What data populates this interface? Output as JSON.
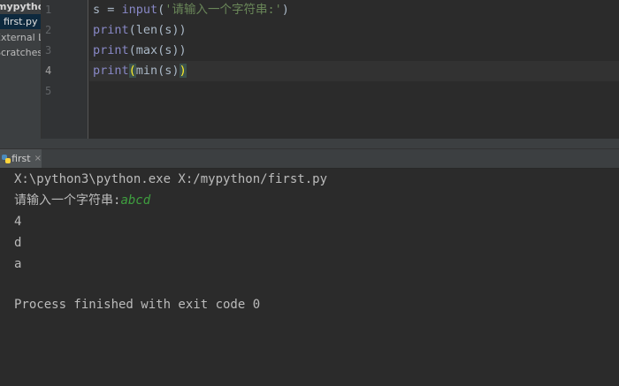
{
  "project_panel": {
    "root": "mypython",
    "file": "first.py",
    "external": "External Libraries",
    "scratches": "Scratches and Consoles"
  },
  "editor": {
    "line_numbers": [
      "1",
      "2",
      "3",
      "4",
      "5"
    ],
    "current_line": "4",
    "lines": [
      {
        "var": "s",
        "op": " = ",
        "fn": "input",
        "open": "(",
        "str": "'请输入一个字符串:'",
        "close": ")"
      },
      {
        "fn": "print",
        "rest": "(len(s))"
      },
      {
        "fn": "print",
        "rest": "(max(s))"
      },
      {
        "fn": "print",
        "open_hl": "(",
        "mid": "min(s)",
        "close_hl": ")"
      }
    ]
  },
  "run": {
    "tab_label": "first",
    "tab_icon": "python-file-icon",
    "console": {
      "command": "X:\\python3\\python.exe X:/mypython/first.py",
      "prompt": "请输入一个字符串:",
      "user_input": "abcd",
      "outputs": [
        "4",
        "d",
        "a"
      ],
      "exit_message": "Process finished with exit code 0"
    }
  },
  "colors": {
    "editor_bg": "#2b2b2b",
    "panel_bg": "#3c3f41",
    "input_green": "#3f9f3f",
    "brace_highlight": "#ffef28"
  }
}
